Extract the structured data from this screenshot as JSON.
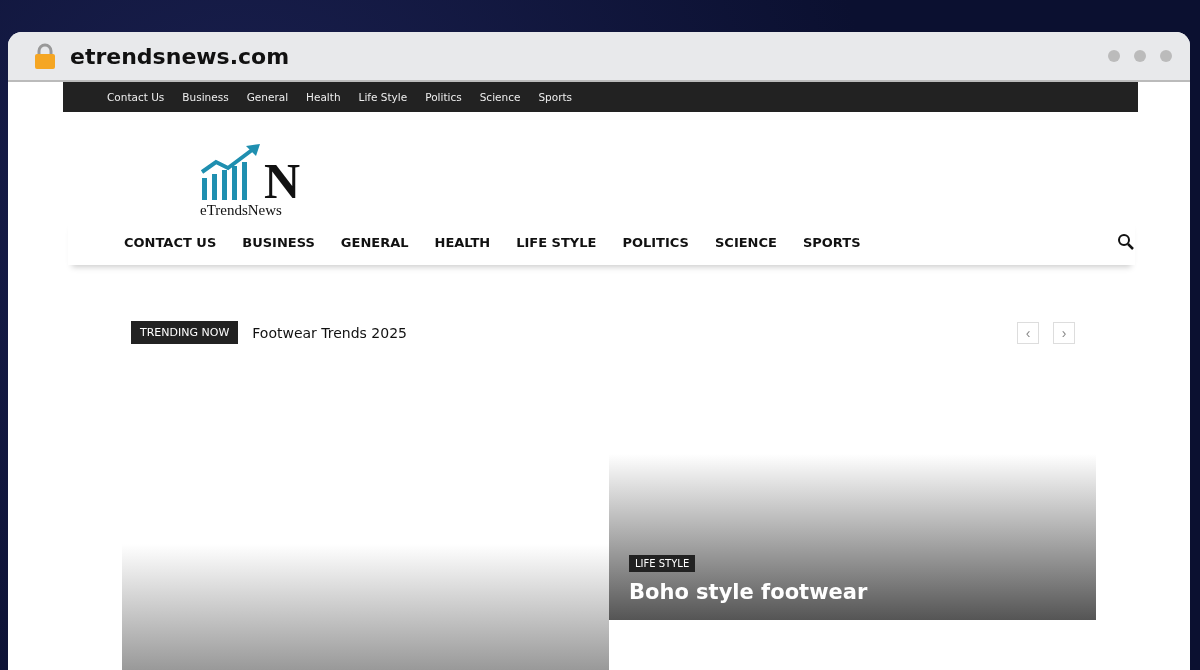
{
  "browser": {
    "address": "etrendsnews.com"
  },
  "top_menu": [
    "Contact Us",
    "Business",
    "General",
    "Health",
    "Life Style",
    "Politics",
    "Science",
    "Sports"
  ],
  "logo": {
    "letter": "N",
    "name": "eTrendsNews"
  },
  "main_menu": [
    "CONTACT US",
    "BUSINESS",
    "GENERAL",
    "HEALTH",
    "LIFE STYLE",
    "POLITICS",
    "SCIENCE",
    "SPORTS"
  ],
  "trending": {
    "label": "TRENDING NOW",
    "headline": "Footwear Trends 2025",
    "prev": "‹",
    "next": "›"
  },
  "posts": [
    {
      "kind": "plain"
    },
    {
      "kind": "captioned",
      "category": "LIFE STYLE",
      "title": "Boho style footwear"
    }
  ]
}
